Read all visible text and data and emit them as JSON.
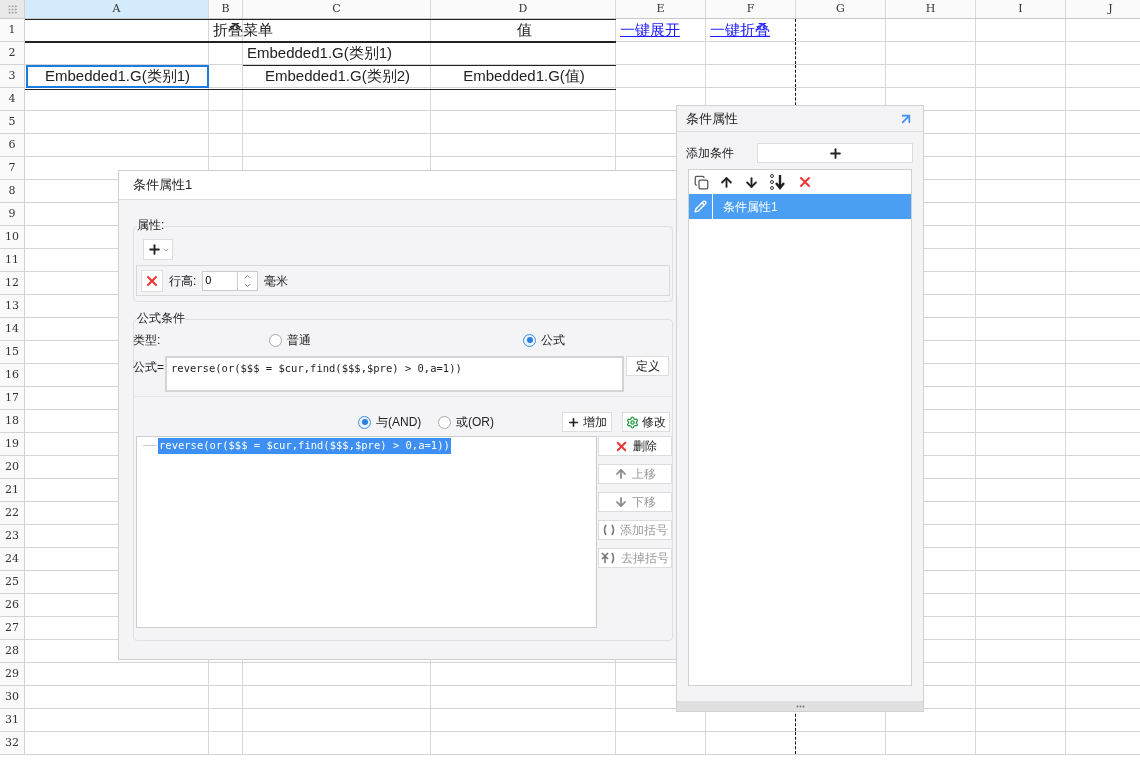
{
  "sheet": {
    "columns": [
      {
        "label": "A",
        "selected": true
      },
      {
        "label": "B",
        "selected": false
      },
      {
        "label": "C",
        "selected": false
      },
      {
        "label": "D",
        "selected": false
      },
      {
        "label": "E",
        "selected": false
      },
      {
        "label": "F",
        "selected": false
      },
      {
        "label": "G",
        "selected": false
      },
      {
        "label": "H",
        "selected": false
      },
      {
        "label": "I",
        "selected": false
      },
      {
        "label": "J",
        "selected": false
      }
    ],
    "rows": [
      {
        "label": "1",
        "cells": [
          {
            "text": "",
            "selected": false
          },
          {
            "text": "折叠菜单",
            "kind": "text",
            "selected": false
          },
          {
            "text": "",
            "selected": false
          },
          {
            "text": "值",
            "kind": "text",
            "selected": false
          },
          {
            "text": "一键展开",
            "kind": "link",
            "selected": false
          },
          {
            "text": "一键折叠",
            "kind": "link",
            "selected": false
          }
        ]
      },
      {
        "label": "2",
        "cells": [
          {
            "text": "",
            "selected": false
          },
          {
            "text": "",
            "selected": false
          },
          {
            "text": "Embedded1.G(类别1)",
            "kind": "text",
            "selected": false
          }
        ]
      },
      {
        "label": "3",
        "cells": [
          {
            "text": "Embedded1.G(类别1)",
            "kind": "text",
            "selected": true
          },
          {
            "text": "",
            "selected": false
          },
          {
            "text": "Embedded1.G(类别2)",
            "kind": "text",
            "selected": false
          },
          {
            "text": "Embedded1.G(值)",
            "kind": "text",
            "selected": false
          }
        ]
      },
      {
        "label": "4",
        "cells": []
      },
      {
        "label": "5",
        "cells": []
      },
      {
        "label": "6",
        "cells": []
      },
      {
        "label": "7",
        "cells": []
      },
      {
        "label": "8",
        "cells": []
      },
      {
        "label": "9",
        "cells": []
      },
      {
        "label": "10",
        "cells": []
      },
      {
        "label": "11",
        "cells": []
      },
      {
        "label": "12",
        "cells": []
      },
      {
        "label": "13",
        "cells": []
      },
      {
        "label": "14",
        "cells": []
      },
      {
        "label": "15",
        "cells": []
      },
      {
        "label": "16",
        "cells": []
      },
      {
        "label": "17",
        "cells": []
      },
      {
        "label": "18",
        "cells": []
      },
      {
        "label": "19",
        "cells": []
      },
      {
        "label": "20",
        "cells": []
      },
      {
        "label": "21",
        "cells": []
      },
      {
        "label": "22",
        "cells": []
      },
      {
        "label": "23",
        "cells": []
      },
      {
        "label": "24",
        "cells": []
      },
      {
        "label": "25",
        "cells": []
      },
      {
        "label": "26",
        "cells": []
      },
      {
        "label": "27",
        "cells": []
      },
      {
        "label": "28",
        "cells": []
      },
      {
        "label": "29",
        "cells": []
      },
      {
        "label": "30",
        "cells": []
      },
      {
        "label": "31",
        "cells": []
      },
      {
        "label": "32",
        "cells": []
      }
    ]
  },
  "condition_dialog": {
    "title": "条件属性1",
    "properties": {
      "legend": "属性:",
      "row_height": {
        "label": "行高:",
        "value": "0",
        "unit": "毫米"
      }
    },
    "formula_condition": {
      "legend": "公式条件",
      "type_label": "类型:",
      "types": [
        {
          "label": "普通",
          "selected": false
        },
        {
          "label": "公式",
          "selected": true
        }
      ],
      "formula_label": "公式=",
      "formula": "reverse(or($$$ = $cur,find($$$,$pre) > 0,a=1))",
      "define_button": "定义",
      "logic": [
        {
          "label": "与(AND)",
          "selected": true
        },
        {
          "label": "或(OR)",
          "selected": false
        }
      ],
      "add_button": "增加",
      "modify_button": "修改",
      "conditions": [
        {
          "text": "reverse(or($$$ = $cur,find($$$,$pre) > 0,a=1))",
          "selected": true
        }
      ],
      "actions": [
        {
          "label": "删除",
          "kind": "delete",
          "disabled": false
        },
        {
          "label": "上移",
          "kind": "up",
          "disabled": true
        },
        {
          "label": "下移",
          "kind": "down",
          "disabled": true
        },
        {
          "label": "添加括号",
          "kind": "add-paren",
          "disabled": true
        },
        {
          "label": "去掉括号",
          "kind": "remove-paren",
          "disabled": true
        }
      ]
    }
  },
  "side_panel": {
    "title": "条件属性",
    "add_label": "添加条件",
    "items": [
      {
        "label": "条件属性1",
        "selected": true
      }
    ]
  }
}
